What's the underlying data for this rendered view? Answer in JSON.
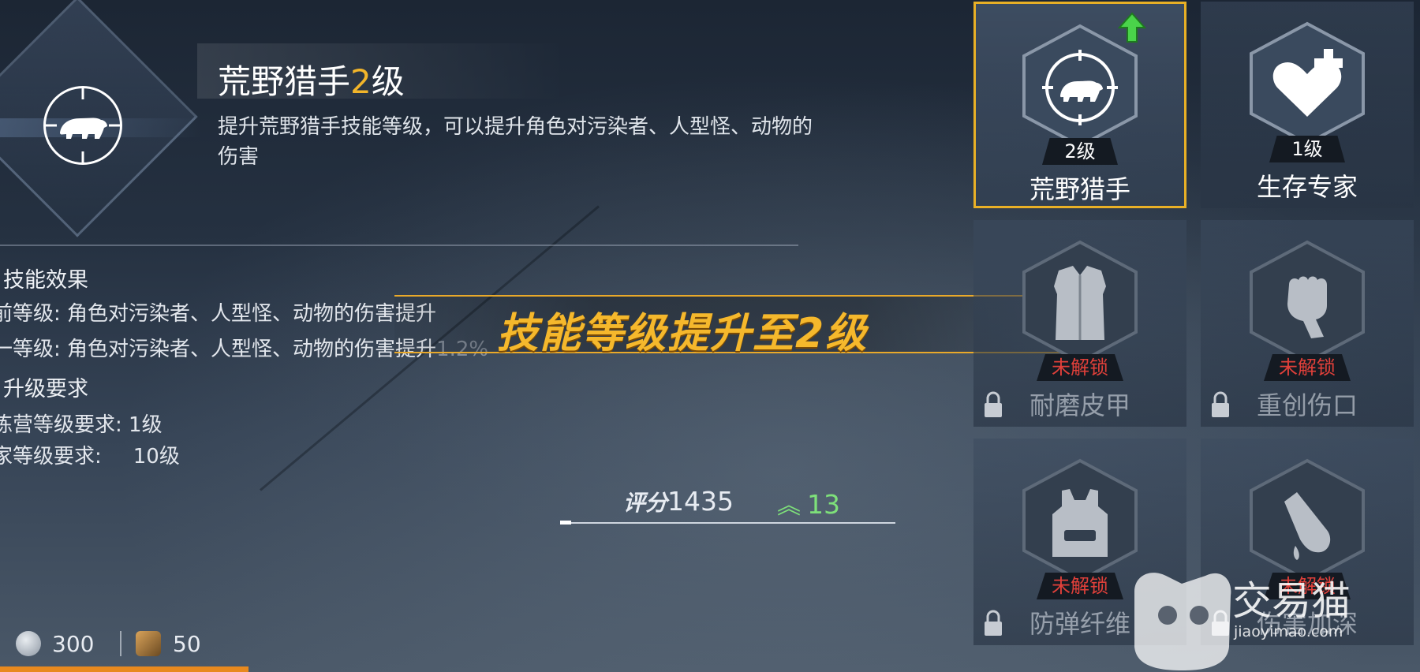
{
  "skill_detail": {
    "title_name": "荒野猎手",
    "title_level": "2",
    "title_suffix": "级",
    "description": "提升荒野猎手技能等级，可以提升角色对污染者、人型怪、动物的伤害",
    "effects_heading": "技能效果",
    "current_level_line": "前等级: 角色对污染者、人型怪、动物的伤害提升",
    "next_level_line": "一等级: 角色对污染者、人型怪、动物的伤害提升",
    "next_level_value": "1.2%",
    "requirements_heading": "升级要求",
    "camp_requirement_label": "练营等级要求:",
    "camp_requirement_value": "1级",
    "player_requirement_label": "家等级要求:",
    "player_requirement_value": "10级"
  },
  "banner": {
    "text": "技能等级提升至2级"
  },
  "score": {
    "label": "评分",
    "value": "1435",
    "increase": "13"
  },
  "currency": {
    "silver": "300",
    "token": "50"
  },
  "skills": [
    {
      "name": "荒野猎手",
      "level": "2级",
      "locked": false,
      "icon": "bear-crosshair-icon",
      "selected": true,
      "upgradable": true
    },
    {
      "name": "生存专家",
      "level": "1级",
      "locked": false,
      "icon": "heart-plus-icon",
      "selected": false,
      "upgradable": false
    },
    {
      "name": "耐磨皮甲",
      "status": "未解锁",
      "locked": true,
      "icon": "leather-vest-icon"
    },
    {
      "name": "重创伤口",
      "status": "未解锁",
      "locked": true,
      "icon": "fist-icon"
    },
    {
      "name": "防弹纤维",
      "status": "未解锁",
      "locked": true,
      "icon": "bulletproof-vest-icon"
    },
    {
      "name": "伤害加深",
      "status": "未解锁",
      "locked": true,
      "icon": "bleeding-hand-icon"
    }
  ],
  "watermark": {
    "brand": "交易猫",
    "url": "jiaoyimao.com"
  },
  "colors": {
    "accent": "#f2b52a",
    "selected_border": "#e9b026",
    "locked_red": "#e0403a",
    "increase_green": "#7ee07a"
  }
}
